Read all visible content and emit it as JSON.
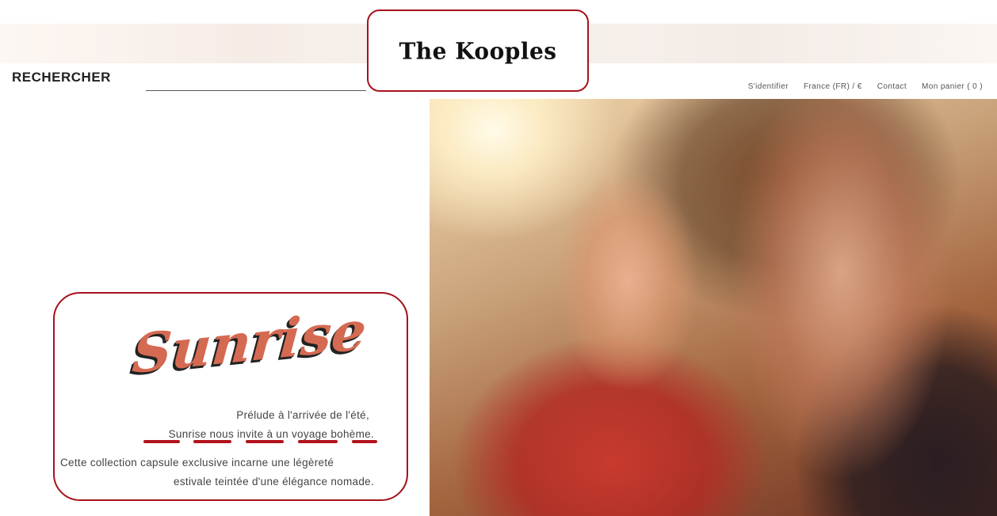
{
  "brand": {
    "logo_text": "The Kooples"
  },
  "search": {
    "label": "RECHERCHER",
    "value": "",
    "placeholder": ""
  },
  "nav": {
    "items": [
      {
        "label": "S'identifier"
      },
      {
        "label": "France (FR) / €"
      },
      {
        "label": "Contact"
      },
      {
        "label": "Mon panier ( 0 )"
      }
    ]
  },
  "promo": {
    "title": "Sunrise",
    "line1": "Prélude à l'arrivée de l'été,",
    "line2": "Sunrise nous invite à un voyage bohème.",
    "line3": "Cette collection capsule exclusive incarne une légèreté",
    "line4": "estivale teintée d'une élégance nomade."
  },
  "colors": {
    "annotation": "#a6121b",
    "title": "#d56a52"
  }
}
